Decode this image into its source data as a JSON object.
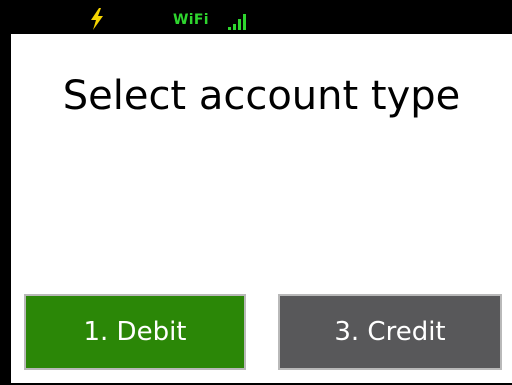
{
  "status_bar": {
    "power_icon": "lightning-bolt-icon",
    "wifi_label": "WiFi",
    "signal_icon": "signal-bars-icon",
    "wifi_color": "#2ed52e",
    "bolt_color": "#f5d400"
  },
  "prompt": {
    "title": "Select account type"
  },
  "options": {
    "debit": {
      "label": "1. Debit",
      "color": "#2b8707"
    },
    "credit": {
      "label": "3. Credit",
      "color": "#58585a"
    }
  }
}
